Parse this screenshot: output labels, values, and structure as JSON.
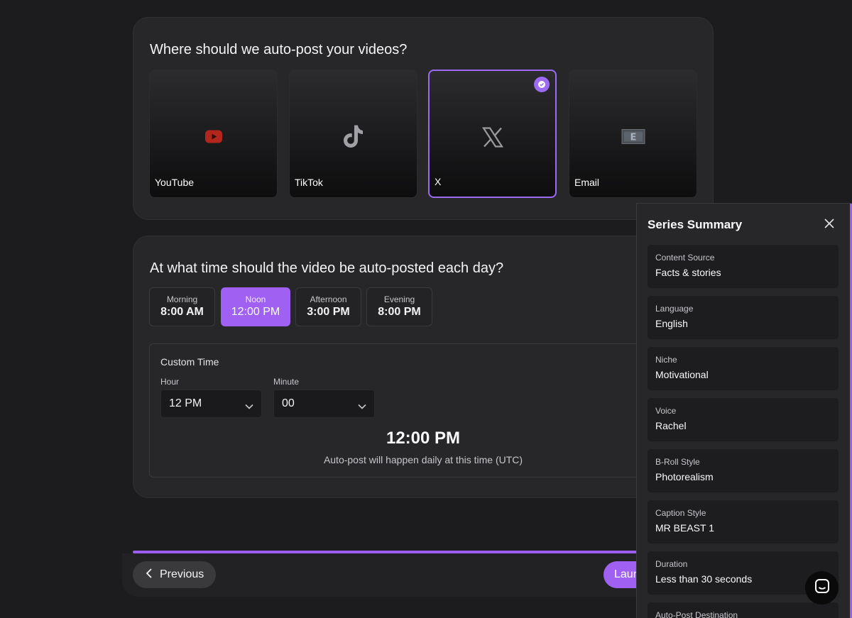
{
  "platforms": {
    "title": "Where should we auto-post your videos?",
    "tiles": [
      {
        "label": "YouTube",
        "icon": "youtube-icon",
        "selected": false
      },
      {
        "label": "TikTok",
        "icon": "tiktok-icon",
        "selected": false
      },
      {
        "label": "X",
        "icon": "x-logo-icon",
        "selected": true
      },
      {
        "label": "Email",
        "icon": "email-icon",
        "selected": false
      }
    ]
  },
  "schedule": {
    "title": "At what time should the video be auto-posted each day?",
    "slots": [
      {
        "label": "Morning",
        "time": "8:00 AM",
        "active": false
      },
      {
        "label": "Noon",
        "time": "12:00 PM",
        "active": true
      },
      {
        "label": "Afternoon",
        "time": "3:00 PM",
        "active": false
      },
      {
        "label": "Evening",
        "time": "8:00 PM",
        "active": false
      }
    ],
    "custom": {
      "title": "Custom Time",
      "hour_label": "Hour",
      "hour_value": "12 PM",
      "minute_label": "Minute",
      "minute_value": "00",
      "display_time": "12:00 PM",
      "note": "Auto-post will happen daily at this time (UTC)"
    }
  },
  "nav": {
    "previous_label": "Previous",
    "launch_label": "Launch"
  },
  "summary": {
    "title": "Series Summary",
    "items": [
      {
        "label": "Content Source",
        "value": "Facts & stories"
      },
      {
        "label": "Language",
        "value": "English"
      },
      {
        "label": "Niche",
        "value": "Motivational"
      },
      {
        "label": "Voice",
        "value": "Rachel"
      },
      {
        "label": "B-Roll Style",
        "value": "Photorealism"
      },
      {
        "label": "Caption Style",
        "value": "MR BEAST 1"
      },
      {
        "label": "Duration",
        "value": "Less than 30 seconds"
      },
      {
        "label": "Auto-Post Destination",
        "value": ""
      }
    ]
  },
  "colors": {
    "accent": "#a061f2",
    "background": "#1c1c1e",
    "card": "#27272a",
    "youtube_red": "#c4302b"
  }
}
